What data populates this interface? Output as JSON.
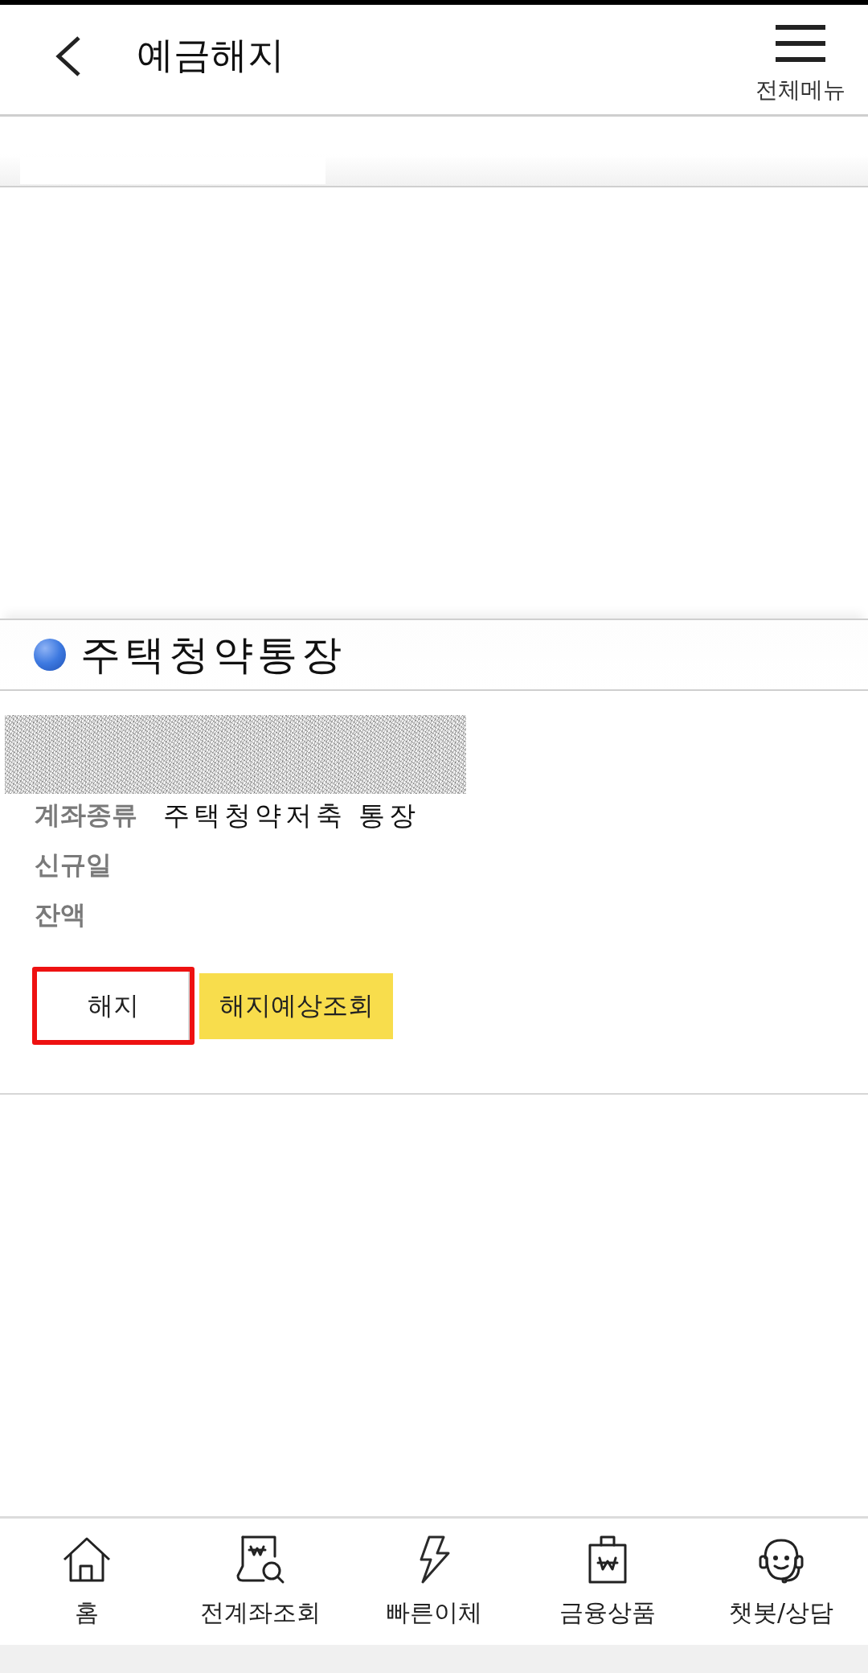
{
  "header": {
    "title": "예금해지",
    "menu_label": "전체메뉴"
  },
  "account": {
    "title": "주택청약통장",
    "details": [
      {
        "label": "계좌종류",
        "value": "주택청약저축 통장"
      },
      {
        "label": "신규일"
      },
      {
        "label": "잔액"
      }
    ],
    "buttons": [
      {
        "label": "해지",
        "kind": "outline",
        "highlighted": true
      },
      {
        "label": "해지예상조회",
        "kind": "primary",
        "highlighted": false
      }
    ]
  },
  "bottom_nav": [
    {
      "label": "홈",
      "kind": "home"
    },
    {
      "label": "전계좌조회",
      "kind": "accounts"
    },
    {
      "label": "빠른이체",
      "kind": "transfer"
    },
    {
      "label": "금융상품",
      "kind": "products"
    },
    {
      "label": "챗봇/상담",
      "kind": "chat"
    }
  ]
}
